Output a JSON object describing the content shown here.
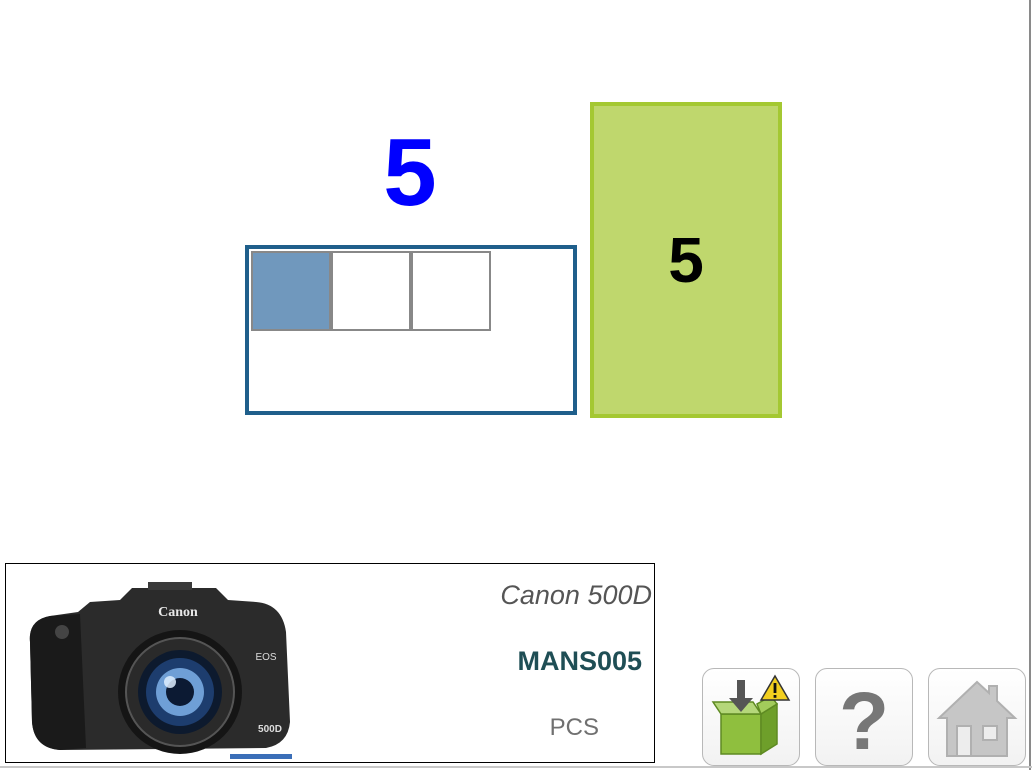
{
  "exercise": {
    "count_label": "5",
    "target_label": "5",
    "grid_cells": [
      {
        "filled": true
      },
      {
        "filled": false
      },
      {
        "filled": false
      }
    ]
  },
  "product": {
    "name": "Canon 500D",
    "code": "MANS005",
    "unit": "PCS",
    "image_icon": "camera-image"
  },
  "toolbar": {
    "buttons": [
      {
        "icon": "receive-box-warning-icon"
      },
      {
        "icon": "question-mark-icon"
      },
      {
        "icon": "home-icon"
      }
    ]
  },
  "colors": {
    "count": "#0000ff",
    "grid_border": "#1f5f8b",
    "grid_filled": "#7098bd",
    "target_fill": "#bfd76d",
    "target_border": "#a4c832"
  }
}
